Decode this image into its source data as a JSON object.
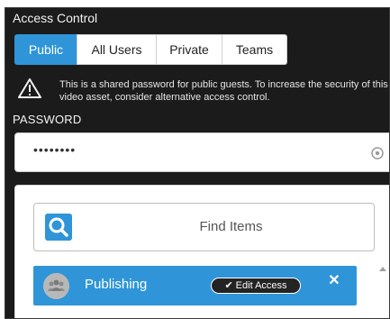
{
  "panel": {
    "title": "Access Control"
  },
  "tabs": [
    {
      "label": "Public",
      "active": true
    },
    {
      "label": "All Users",
      "active": false
    },
    {
      "label": "Private",
      "active": false
    },
    {
      "label": "Teams",
      "active": false
    }
  ],
  "warning": {
    "icon": "warning-triangle-icon",
    "text": "This is a shared password for public guests. To increase the security of this video asset, consider alternative access control."
  },
  "password": {
    "label": "PASSWORD",
    "value": "••••••••",
    "reveal_icon": "eye-icon"
  },
  "search": {
    "icon": "search-icon",
    "label": "Find Items"
  },
  "items": [
    {
      "avatar_icon": "group-icon",
      "label": "Publishing",
      "edit_label": "Edit Access",
      "edit_icon": "check-icon",
      "remove_icon": "close-icon"
    }
  ],
  "colors": {
    "accent": "#2f95d8",
    "panel_bg": "#1b1b1b",
    "badge_bg": "#232323"
  }
}
